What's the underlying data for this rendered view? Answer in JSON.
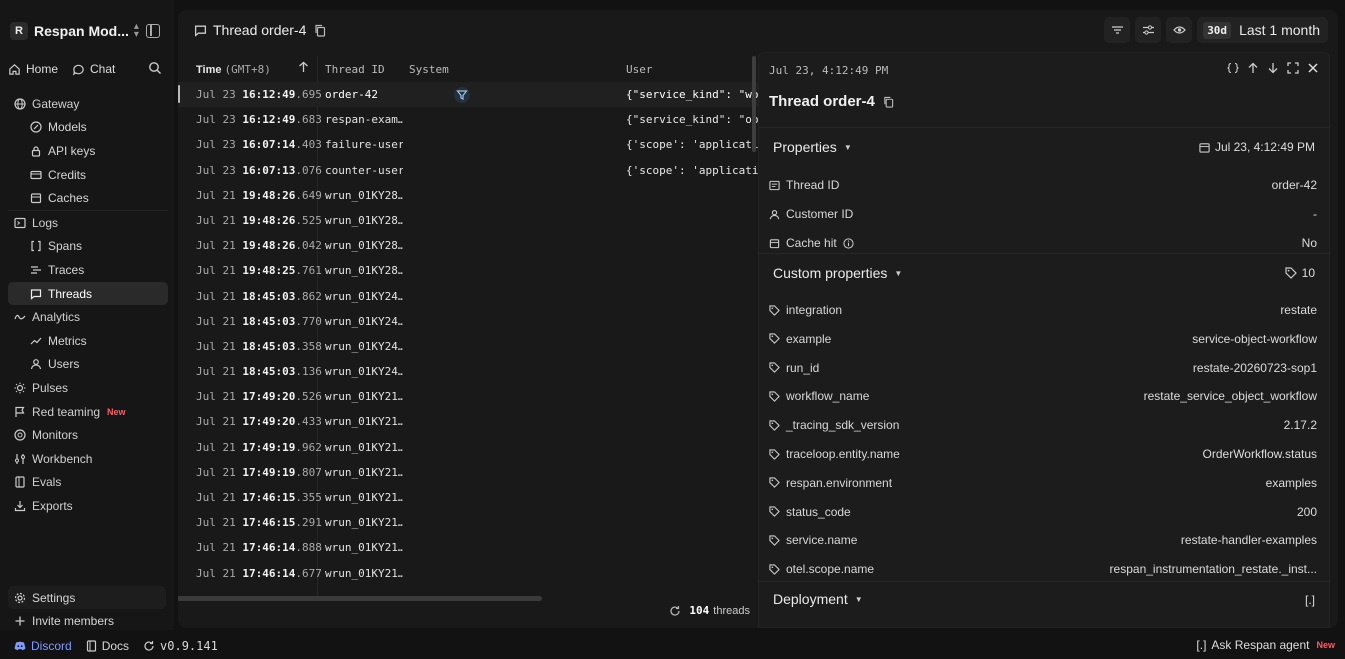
{
  "workspace": {
    "initial": "R",
    "name": "Respan Mod..."
  },
  "homebar": {
    "home": "Home",
    "chat": "Chat"
  },
  "nav": {
    "gateway": "Gateway",
    "models": "Models",
    "api_keys": "API keys",
    "credits": "Credits",
    "caches": "Caches",
    "logs": "Logs",
    "spans": "Spans",
    "traces": "Traces",
    "threads": "Threads",
    "analytics": "Analytics",
    "metrics": "Metrics",
    "users": "Users",
    "pulses": "Pulses",
    "red_teaming": "Red teaming",
    "red_teaming_badge": "New",
    "monitors": "Monitors",
    "workbench": "Workbench",
    "evals": "Evals",
    "exports": "Exports"
  },
  "settings": "Settings",
  "invite": "Invite members",
  "footer": {
    "discord": "Discord",
    "docs": "Docs",
    "version": "v0.9.141",
    "agent_bracket": "[.]",
    "agent": "Ask Respan agent",
    "agent_badge": "New"
  },
  "topbar": {
    "title": "Thread order-4",
    "range_chip": "30d",
    "range_label": "Last 1 month"
  },
  "table": {
    "headers": {
      "time": "Time",
      "time_unit": "(GMT+8)",
      "thread_id": "Thread ID",
      "system": "System",
      "user": "User"
    },
    "rows": [
      {
        "date": "Jul 23",
        "hms": "16:12:49",
        "ms": ".695",
        "thread_id": "order-42",
        "user": "{\"service_kind\": \"workflo"
      },
      {
        "date": "Jul 23",
        "hms": "16:12:49",
        "ms": ".683",
        "thread_id": "respan-exam…",
        "user": "{\"service_kind\": \"object\""
      },
      {
        "date": "Jul 23",
        "hms": "16:07:14",
        "ms": ".403",
        "thread_id": "failure-user",
        "user": "{'scope': 'application', 'a"
      },
      {
        "date": "Jul 23",
        "hms": "16:07:13",
        "ms": ".076",
        "thread_id": "counter-user",
        "user": "{'scope': 'application', 'ap"
      },
      {
        "date": "Jul 21",
        "hms": "19:48:26",
        "ms": ".649",
        "thread_id": "wrun_01KY28…",
        "user": ""
      },
      {
        "date": "Jul 21",
        "hms": "19:48:26",
        "ms": ".525",
        "thread_id": "wrun_01KY28…",
        "user": ""
      },
      {
        "date": "Jul 21",
        "hms": "19:48:26",
        "ms": ".042",
        "thread_id": "wrun_01KY28…",
        "user": ""
      },
      {
        "date": "Jul 21",
        "hms": "19:48:25",
        "ms": ".761",
        "thread_id": "wrun_01KY28…",
        "user": ""
      },
      {
        "date": "Jul 21",
        "hms": "18:45:03",
        "ms": ".862",
        "thread_id": "wrun_01KY24…",
        "user": ""
      },
      {
        "date": "Jul 21",
        "hms": "18:45:03",
        "ms": ".770",
        "thread_id": "wrun_01KY24…",
        "user": ""
      },
      {
        "date": "Jul 21",
        "hms": "18:45:03",
        "ms": ".358",
        "thread_id": "wrun_01KY24…",
        "user": ""
      },
      {
        "date": "Jul 21",
        "hms": "18:45:03",
        "ms": ".136",
        "thread_id": "wrun_01KY24…",
        "user": ""
      },
      {
        "date": "Jul 21",
        "hms": "17:49:20",
        "ms": ".526",
        "thread_id": "wrun_01KY21…",
        "user": ""
      },
      {
        "date": "Jul 21",
        "hms": "17:49:20",
        "ms": ".433",
        "thread_id": "wrun_01KY21…",
        "user": ""
      },
      {
        "date": "Jul 21",
        "hms": "17:49:19",
        "ms": ".962",
        "thread_id": "wrun_01KY21…",
        "user": ""
      },
      {
        "date": "Jul 21",
        "hms": "17:49:19",
        "ms": ".807",
        "thread_id": "wrun_01KY21…",
        "user": ""
      },
      {
        "date": "Jul 21",
        "hms": "17:46:15",
        "ms": ".355",
        "thread_id": "wrun_01KY21…",
        "user": ""
      },
      {
        "date": "Jul 21",
        "hms": "17:46:15",
        "ms": ".291",
        "thread_id": "wrun_01KY21…",
        "user": ""
      },
      {
        "date": "Jul 21",
        "hms": "17:46:14",
        "ms": ".888",
        "thread_id": "wrun_01KY21…",
        "user": ""
      },
      {
        "date": "Jul 21",
        "hms": "17:46:14",
        "ms": ".677",
        "thread_id": "wrun_01KY21…",
        "user": ""
      }
    ],
    "count": "104",
    "count_label": "threads"
  },
  "detail": {
    "timestamp": "Jul 23, 4:12:49 PM",
    "title": "Thread order-4",
    "properties_label": "Properties",
    "properties_date": "Jul 23, 4:12:49 PM",
    "properties": [
      {
        "key": "Thread ID",
        "value": "order-42"
      },
      {
        "key": "Customer ID",
        "value": "-"
      },
      {
        "key": "Cache hit",
        "value": "No"
      }
    ],
    "custom_label": "Custom properties",
    "custom_count": "10",
    "custom": [
      {
        "key": "integration",
        "value": "restate"
      },
      {
        "key": "example",
        "value": "service-object-workflow"
      },
      {
        "key": "run_id",
        "value": "restate-20260723-sop1"
      },
      {
        "key": "workflow_name",
        "value": "restate_service_object_workflow"
      },
      {
        "key": "_tracing_sdk_version",
        "value": "2.17.2"
      },
      {
        "key": "traceloop.entity.name",
        "value": "OrderWorkflow.status"
      },
      {
        "key": "respan.environment",
        "value": "examples"
      },
      {
        "key": "status_code",
        "value": "200"
      },
      {
        "key": "service.name",
        "value": "restate-handler-examples"
      },
      {
        "key": "otel.scope.name",
        "value": "respan_instrumentation_restate._inst..."
      }
    ],
    "deployment_label": "Deployment",
    "deployment_right": "[.]"
  }
}
